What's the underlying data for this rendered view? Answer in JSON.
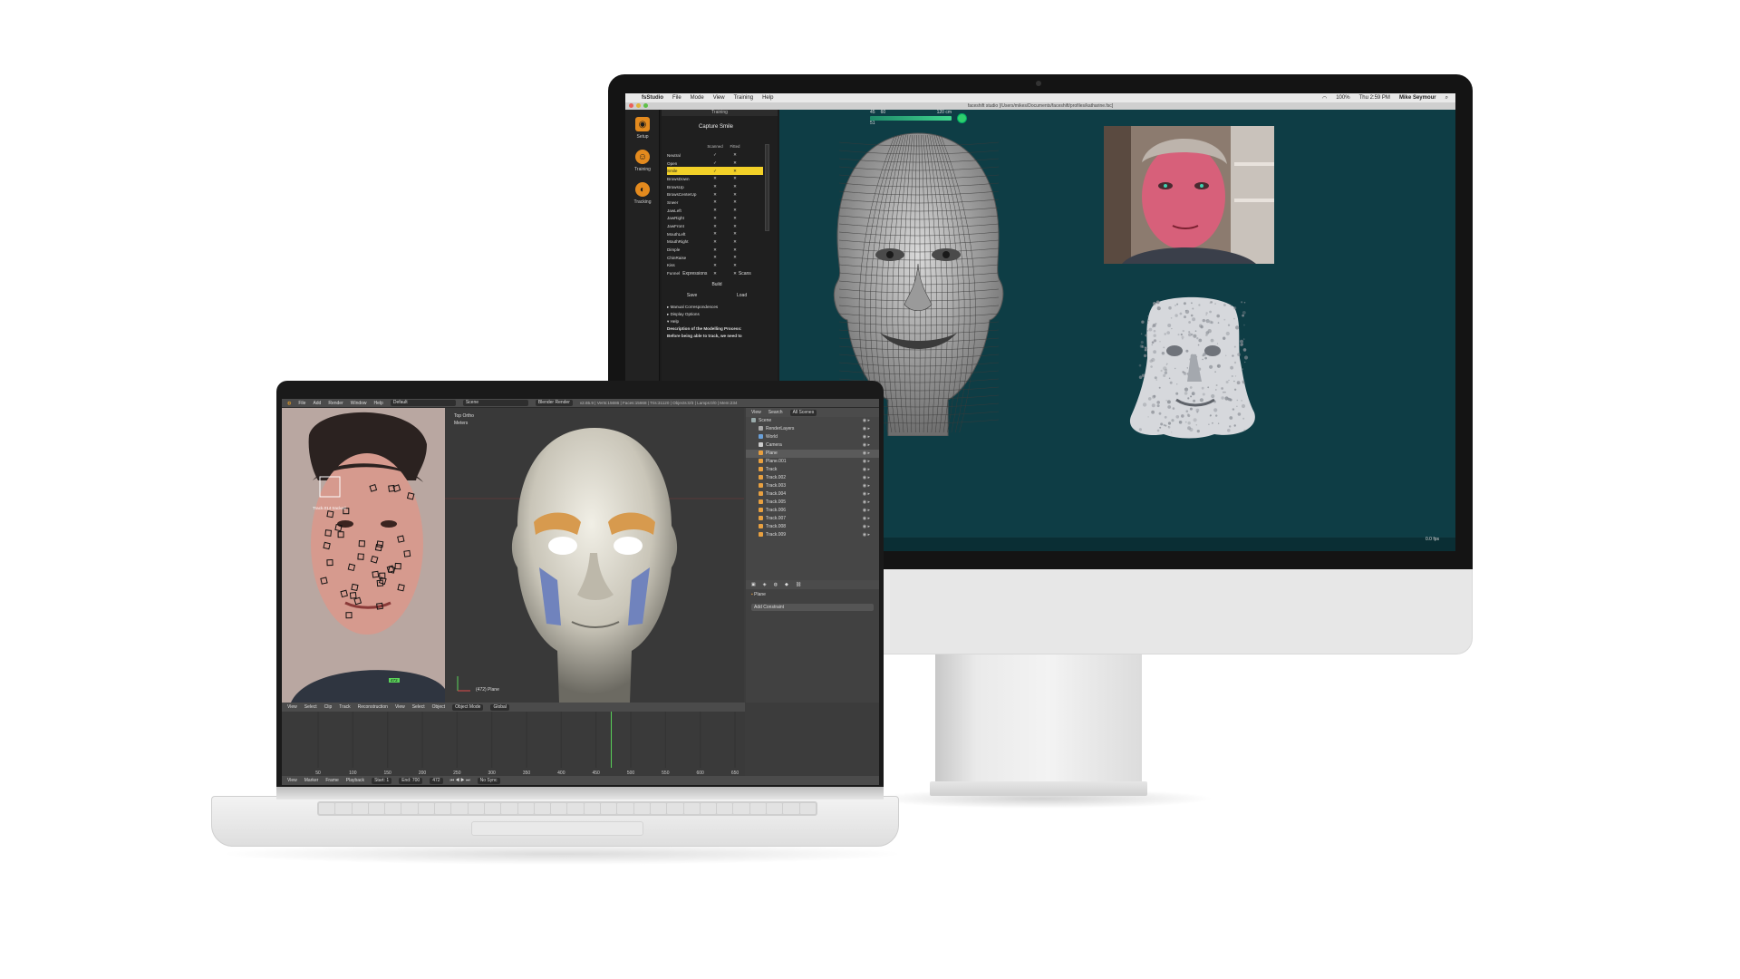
{
  "imac": {
    "menubar": {
      "app_name": "fsStudio",
      "menus": [
        "File",
        "Mode",
        "View",
        "Training",
        "Help"
      ],
      "battery": "100%",
      "clock": "Thu 2:59 PM",
      "user": "Mike Seymour"
    },
    "window_title": "faceshift studio [/Users/mikes/Documents/faceshift/profiles/katharine.fsc]",
    "sidebar_tools": [
      {
        "label": "Setup",
        "icon": "camera-icon"
      },
      {
        "label": "Training",
        "icon": "smiley-icon"
      },
      {
        "label": "Tracking",
        "icon": "face-icon"
      }
    ],
    "panel_title": "Training",
    "capture_label": "Capture Smile",
    "table_headers": [
      "Scanned",
      "Fitted"
    ],
    "expressions": [
      "Neutral",
      "Open",
      "Smile",
      "BrowsDown",
      "BrowsUp",
      "BrowsCenterUp",
      "Sneer",
      "JawLeft",
      "JawRight",
      "JawFront",
      "MouthLeft",
      "MouthRight",
      "Dimple",
      "ChinRaise",
      "Kiss",
      "Funnel"
    ],
    "highlighted_expression": "Smile",
    "tabs": [
      "Expressions",
      "Scans"
    ],
    "build_label": "Build",
    "save_label": "Save",
    "load_label": "Load",
    "tree_items": [
      "Manual Correspondences",
      "Display Options",
      "Help"
    ],
    "help_text": [
      "Description of the Modelling Process:",
      "Before being able to track, we need to"
    ],
    "meter_values": [
      "45",
      "60",
      "120 cm",
      "51"
    ],
    "fps": "0.0 fps",
    "colors": {
      "viewport_bg": "#0e3d45",
      "highlight": "#f2d028",
      "accent": "#e38a1e"
    }
  },
  "laptop": {
    "top_menus": [
      "File",
      "Add",
      "Render",
      "Window",
      "Help"
    ],
    "layout_field": "Default",
    "scene_field": "Scene",
    "render_engine": "Blender Render",
    "stats": "v2.65.9 | Verts:15686 | Faces:15668 | Tris:31120 | Objects:0/3 | Lamps:0/0 | Mem:234",
    "tracker_label": "Track.014  tracked",
    "frame_badge": "472",
    "view_label_1": "Top Ortho",
    "view_label_2": "Meters",
    "object_label": "(472) Plane",
    "outliner": {
      "view": "View",
      "search": "Search",
      "filter": "All Scenes",
      "items": [
        "Scene",
        "RenderLayers",
        "World",
        "Camera",
        "Plane",
        "Plane.001",
        "Track",
        "Track.002",
        "Track.003",
        "Track.004",
        "Track.005",
        "Track.006",
        "Track.007",
        "Track.008",
        "Track.009"
      ]
    },
    "props": {
      "object": "Plane",
      "add_constraint": "Add Constraint"
    },
    "clip_header": [
      "View",
      "Select",
      "Clip",
      "Track",
      "Reconstruction"
    ],
    "view3d_header": [
      "View",
      "Select",
      "Object"
    ],
    "mode": "Object Mode",
    "pivot": "Global",
    "timeline_ticks": [
      "50",
      "100",
      "150",
      "200",
      "250",
      "300",
      "350",
      "400",
      "450",
      "500",
      "550",
      "600",
      "650"
    ],
    "footer_menus": [
      "View",
      "Marker",
      "Frame",
      "Playback"
    ],
    "start": "Start: 1",
    "end": "End: 700",
    "current": "472",
    "sync": "No Sync"
  }
}
